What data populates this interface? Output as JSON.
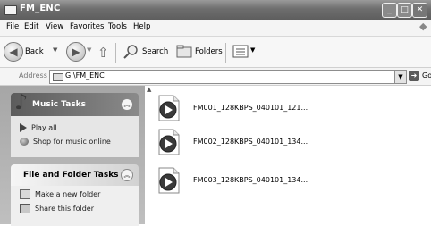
{
  "window": {
    "title": "FM_ENC"
  },
  "menu": {
    "items": [
      "File",
      "Edit",
      "View",
      "Favorites",
      "Tools",
      "Help"
    ]
  },
  "toolbar": {
    "back_label": "Back",
    "search_label": "Search",
    "folders_label": "Folders"
  },
  "address": {
    "label": "Address",
    "path": "G:\\FM_ENC",
    "go_label": "Go"
  },
  "tasks": {
    "music": {
      "title": "Music Tasks",
      "items": [
        "Play all",
        "Shop for music online"
      ]
    },
    "file_folder": {
      "title": "File and Folder Tasks",
      "items": [
        "Make a new folder",
        "Share this folder"
      ]
    }
  },
  "files": [
    {
      "name": "FM001_128KBPS_040101_121..."
    },
    {
      "name": "FM002_128KBPS_040101_134..."
    },
    {
      "name": "FM003_128KBPS_040101_134..."
    }
  ]
}
